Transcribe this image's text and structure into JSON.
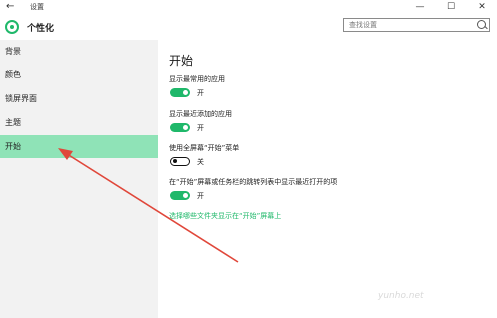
{
  "window": {
    "back_glyph": "←",
    "title": "设置",
    "minimize": "—",
    "maximize": "☐",
    "close": "✕"
  },
  "header": {
    "app_title": "个性化",
    "app_icon": "gear-icon"
  },
  "search": {
    "placeholder": "查找设置"
  },
  "sidebar": {
    "items": [
      {
        "label": "背景",
        "active": false
      },
      {
        "label": "颜色",
        "active": false
      },
      {
        "label": "锁屏界面",
        "active": false
      },
      {
        "label": "主题",
        "active": false
      },
      {
        "label": "开始",
        "active": true
      }
    ]
  },
  "main": {
    "title": "开始",
    "settings": [
      {
        "label": "显示最常用的应用",
        "state": "开",
        "on": true
      },
      {
        "label": "显示最近添加的应用",
        "state": "开",
        "on": true
      },
      {
        "label": "使用全屏幕“开始”菜单",
        "state": "关",
        "on": false
      },
      {
        "label": "在“开始”屏幕或任务栏的跳转列表中显示最近打开的项",
        "state": "开",
        "on": true
      }
    ],
    "link": "选择哪些文件夹显示在“开始”屏幕上"
  },
  "watermark": "yunho.net",
  "colors": {
    "accent": "#1fb86a",
    "sidebar_active": "#8fe3b7",
    "arrow": "#e0473a"
  }
}
